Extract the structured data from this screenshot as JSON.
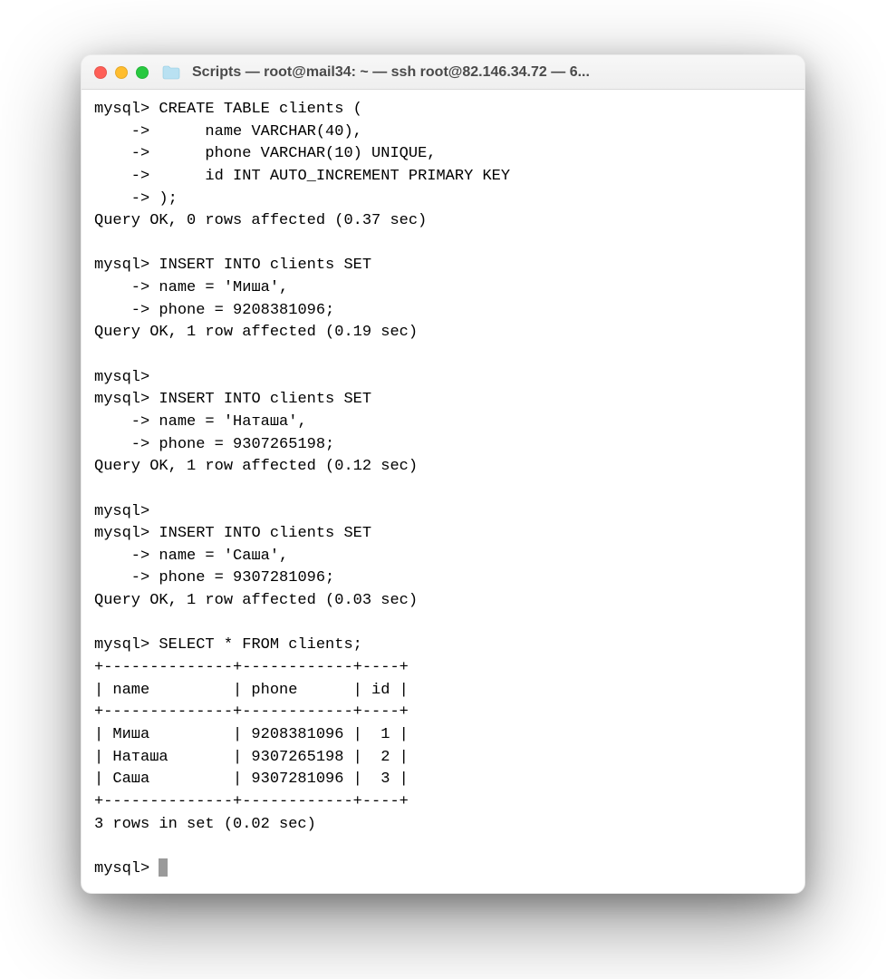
{
  "titlebar": {
    "title": "Scripts — root@mail34: ~ — ssh root@82.146.34.72 — 6..."
  },
  "traffic_lights": {
    "close": "close",
    "minimize": "minimize",
    "zoom": "zoom"
  },
  "terminal": {
    "mysql_prompt": "mysql> ",
    "cont_prompt": "    -> ",
    "create_line": "CREATE TABLE clients (",
    "create_name": "     name VARCHAR(40),",
    "create_phone": "     phone VARCHAR(10) UNIQUE,",
    "create_id": "     id INT AUTO_INCREMENT PRIMARY KEY",
    "create_close": ");",
    "q_create": "Query OK, 0 rows affected (0.37 sec)",
    "insert_set": "INSERT INTO clients SET",
    "ins1_name": "name = 'Миша',",
    "ins1_phone": "phone = 9208381096;",
    "q_ins1": "Query OK, 1 row affected (0.19 sec)",
    "ins2_name": "name = 'Наташа',",
    "ins2_phone": "phone = 9307265198;",
    "q_ins2": "Query OK, 1 row affected (0.12 sec)",
    "ins3_name": "name = 'Саша',",
    "ins3_phone": "phone = 9307281096;",
    "q_ins3": "Query OK, 1 row affected (0.03 sec)",
    "select_line": "SELECT * FROM clients;",
    "table_sep": "+--------------+------------+----+",
    "table_head": "| name         | phone      | id |",
    "row1": "| Миша         | 9208381096 |  1 |",
    "row2": "| Наташа       | 9307265198 |  2 |",
    "row3": "| Саша         | 9307281096 |  3 |",
    "rows_in_set": "3 rows in set (0.02 sec)"
  }
}
